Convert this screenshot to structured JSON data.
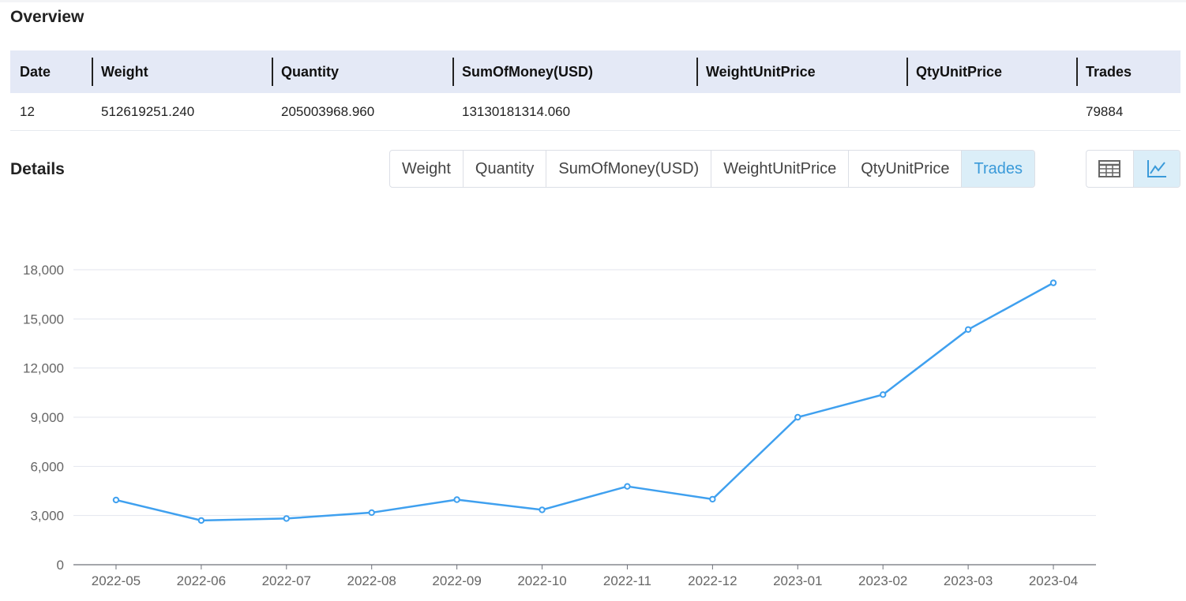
{
  "overview": {
    "title": "Overview",
    "columns": [
      "Date",
      "Weight",
      "Quantity",
      "SumOfMoney(USD)",
      "WeightUnitPrice",
      "QtyUnitPrice",
      "Trades"
    ],
    "row": [
      "12",
      "512619251.240",
      "205003968.960",
      "13130181314.060",
      "",
      "",
      "79884"
    ]
  },
  "details": {
    "title": "Details",
    "tabs": [
      "Weight",
      "Quantity",
      "SumOfMoney(USD)",
      "WeightUnitPrice",
      "QtyUnitPrice",
      "Trades"
    ],
    "active_tab": "Trades",
    "view_buttons": [
      {
        "icon": "table-icon",
        "active": false
      },
      {
        "icon": "line-chart-icon",
        "active": true
      }
    ]
  },
  "colors": {
    "accent": "#3a9ad9",
    "line": "#3fa0ef",
    "header_bg": "#e4e9f6",
    "active_bg": "#dbeef8"
  },
  "chart_data": {
    "type": "line",
    "x": [
      "2022-05",
      "2022-06",
      "2022-07",
      "2022-08",
      "2022-09",
      "2022-10",
      "2022-11",
      "2022-12",
      "2023-01",
      "2023-02",
      "2023-03",
      "2023-04"
    ],
    "series": [
      {
        "values": [
          3950,
          2700,
          2820,
          3180,
          3970,
          3350,
          4780,
          4000,
          9000,
          10380,
          14350,
          17200
        ]
      }
    ],
    "ylim": [
      0,
      18000
    ],
    "yticks": [
      "0",
      "3,000",
      "6,000",
      "9,000",
      "12,000",
      "15,000",
      "18,000"
    ],
    "grid": true,
    "title": "",
    "xlabel": "",
    "ylabel": ""
  }
}
